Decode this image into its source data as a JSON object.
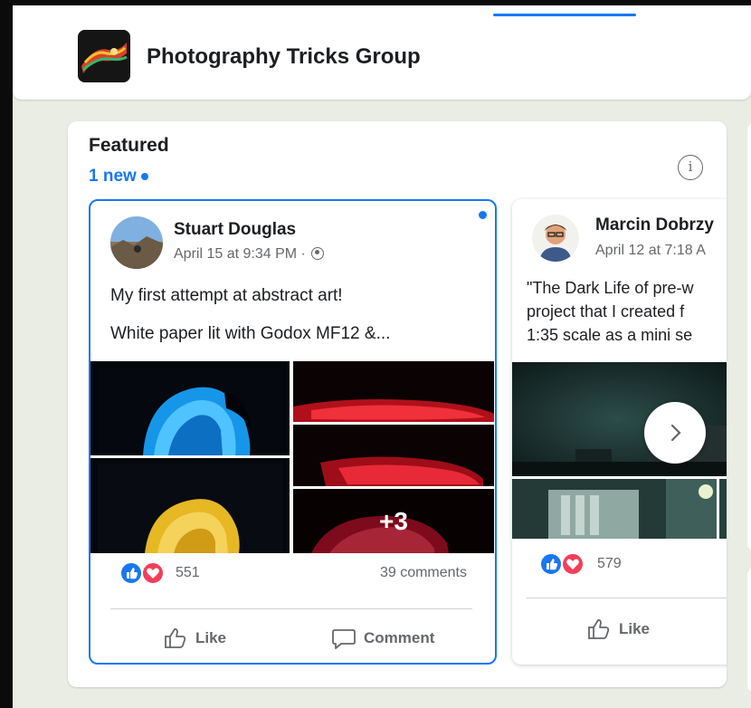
{
  "group": {
    "name": "Photography Tricks Group"
  },
  "featured": {
    "title": "Featured",
    "new_label": "1 new",
    "info_icon": "info-icon"
  },
  "posts": [
    {
      "author": "Stuart Douglas",
      "timestamp": "April 15 at 9:34 PM ·",
      "privacy_icon": "globe-icon",
      "lines": [
        "My first attempt at abstract art!",
        "White paper lit with Godox MF12 &..."
      ],
      "more_photos": "+3",
      "reaction_count": "551",
      "comment_count": "39 comments",
      "like_label": "Like",
      "comment_label": "Comment",
      "unread": true
    },
    {
      "author": "Marcin Dobrzy",
      "timestamp": "April 12 at 7:18 A",
      "lines": [
        "\"The Dark Life of pre-w",
        "project that I created f",
        "1:35 scale as a mini se"
      ],
      "reaction_count": "579",
      "like_label": "Like"
    }
  ],
  "colors": {
    "accent": "#1877f2",
    "love": "#f33e58",
    "page_bg": "#e9ede4"
  }
}
